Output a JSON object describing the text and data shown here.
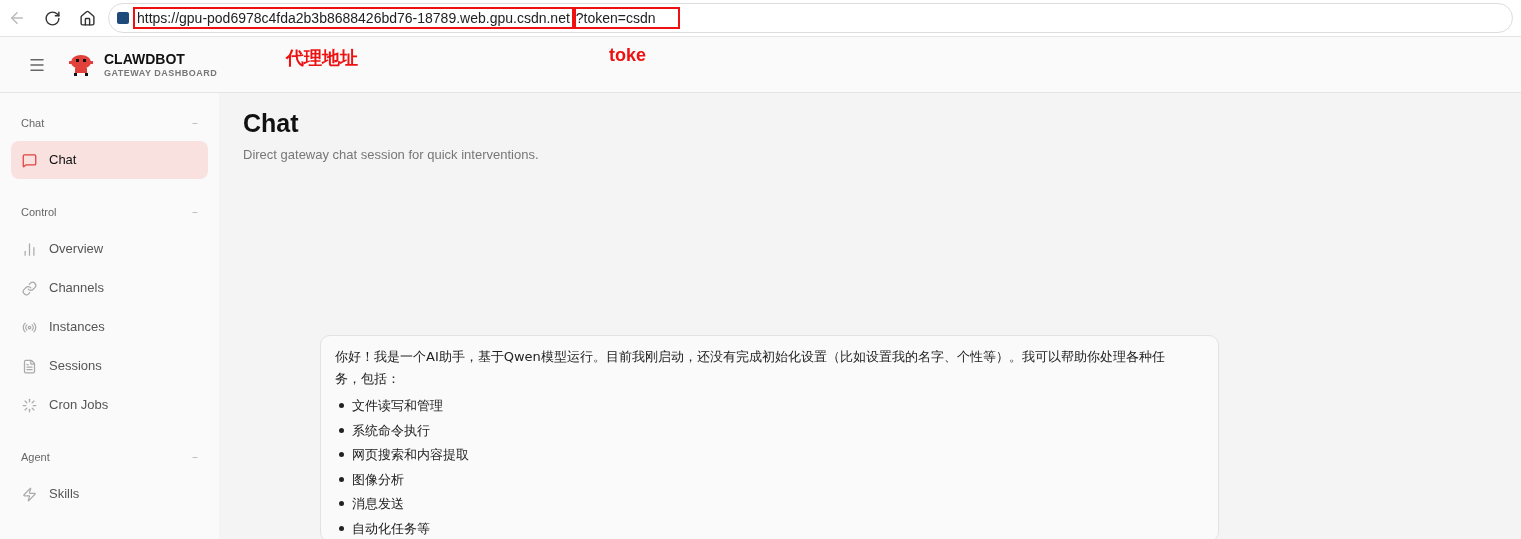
{
  "browser": {
    "url_host": "https://gpu-pod6978c4fda2b3b8688426bd76-18789.web.gpu.csdn.net",
    "url_query": "?token=csdn"
  },
  "annotations": [
    {
      "text": "代理地址"
    },
    {
      "text": "toke"
    }
  ],
  "app": {
    "brand": "CLAWDBOT",
    "subtitle": "GATEWAY DASHBOARD"
  },
  "sidebar": {
    "groups": [
      {
        "title": "Chat",
        "collapse": "−",
        "items": [
          {
            "label": "Chat",
            "selected": true
          }
        ]
      },
      {
        "title": "Control",
        "collapse": "−",
        "items": [
          {
            "label": "Overview",
            "selected": false
          },
          {
            "label": "Channels",
            "selected": false
          },
          {
            "label": "Instances",
            "selected": false
          },
          {
            "label": "Sessions",
            "selected": false
          },
          {
            "label": "Cron Jobs",
            "selected": false
          }
        ]
      },
      {
        "title": "Agent",
        "collapse": "−",
        "items": [
          {
            "label": "Skills",
            "selected": false
          }
        ]
      }
    ]
  },
  "page": {
    "title": "Chat",
    "subtitle": "Direct gateway chat session for quick interventions."
  },
  "message": {
    "intro": "你好！我是一个AI助手，基于Qwen模型运行。目前我刚启动，还没有完成初始化设置（比如设置我的名字、个性等）。我可以帮助你处理各种任务，包括：",
    "items": [
      "文件读写和管理",
      "系统命令执行",
      "网页搜索和内容提取",
      "图像分析",
      "消息发送",
      "自动化任务等"
    ]
  }
}
